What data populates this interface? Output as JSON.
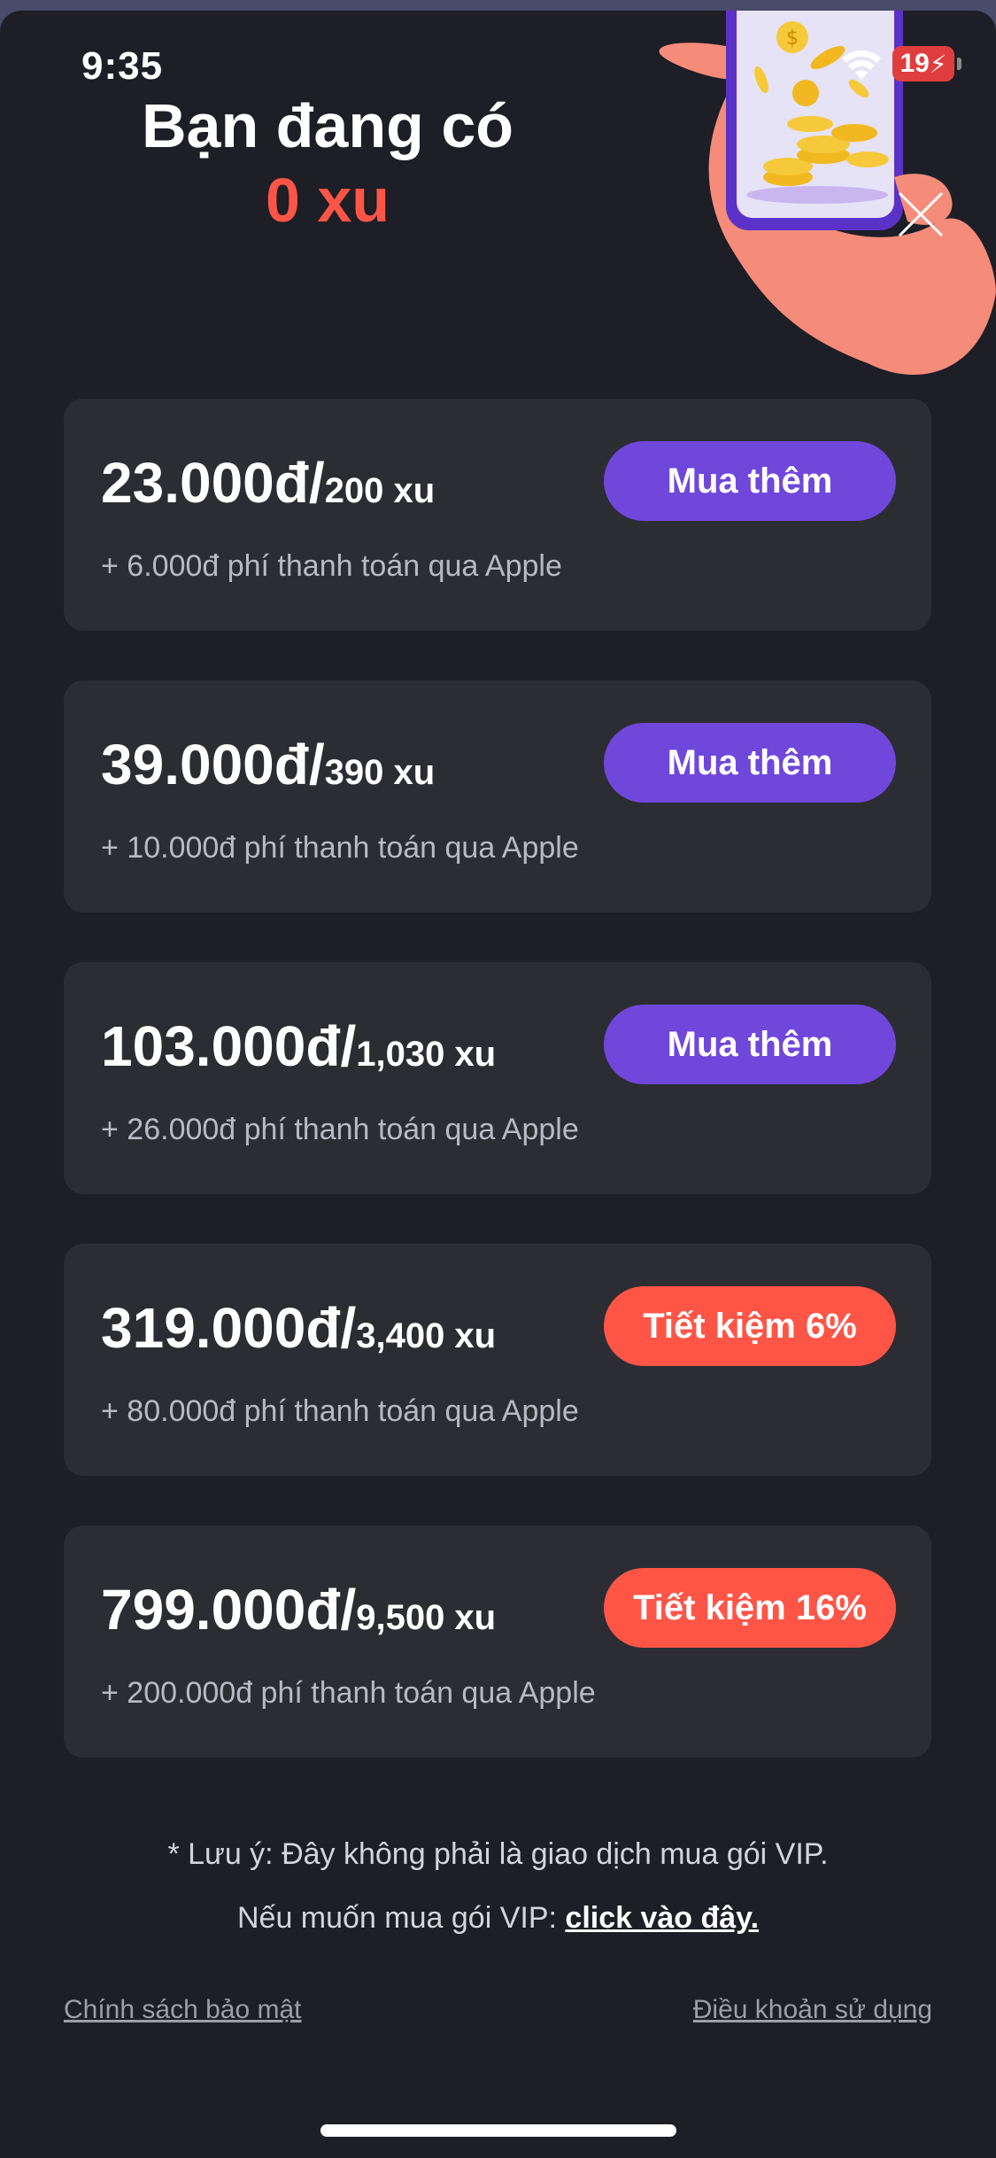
{
  "status_bar": {
    "time": "9:35",
    "battery": "19"
  },
  "balance": {
    "label": "Bạn đang có",
    "value": "0 xu"
  },
  "packages": [
    {
      "price": "23.000đ/",
      "coins": "200 xu",
      "fee": "+ 6.000đ phí thanh toán qua Apple",
      "button": "Mua thêm",
      "button_color": "#7047db"
    },
    {
      "price": "39.000đ/",
      "coins": "390 xu",
      "fee": "+ 10.000đ phí thanh toán qua Apple",
      "button": "Mua thêm",
      "button_color": "#7047db"
    },
    {
      "price": "103.000đ/",
      "coins": "1,030 xu",
      "fee": "+ 26.000đ phí thanh toán qua Apple",
      "button": "Mua thêm",
      "button_color": "#7047db"
    },
    {
      "price": "319.000đ/",
      "coins": "3,400 xu",
      "fee": "+ 80.000đ phí thanh toán qua Apple",
      "button": "Tiết kiệm 6%",
      "button_color": "#ff5547"
    },
    {
      "price": "799.000đ/",
      "coins": "9,500 xu",
      "fee": "+ 200.000đ phí thanh toán qua Apple",
      "button": "Tiết kiệm 16%",
      "button_color": "#ff5547"
    }
  ],
  "notice": {
    "line1": "* Lưu ý: Đây không phải là giao dịch mua gói VIP.",
    "line2_prefix": "Nếu muốn mua gói VIP: ",
    "line2_link": "click vào đây."
  },
  "footer": {
    "privacy": "Chính sách bảo mật",
    "terms": "Điều khoản sử dụng"
  },
  "colors": {
    "background": "#1d1e26",
    "card": "#2c2d33",
    "accent_purple": "#7047db",
    "accent_red": "#ff5547"
  }
}
